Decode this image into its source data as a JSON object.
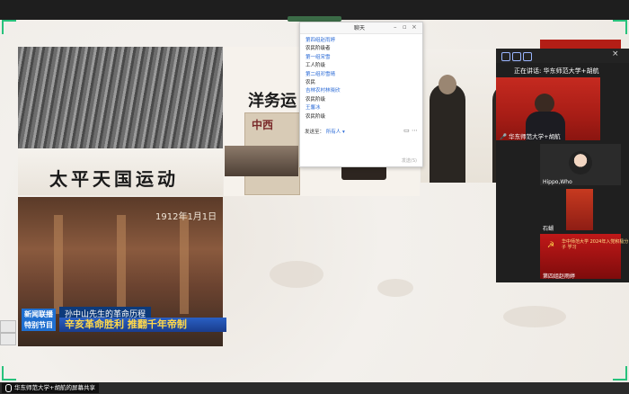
{
  "chat": {
    "title": "聊天",
    "messages": [
      {
        "name": "第四组赵雨婷",
        "text": "农民阶级者"
      },
      {
        "name": "第一组宋雪",
        "text": "工人阶级"
      },
      {
        "name": "第二组邓雪晴",
        "text": "农民"
      },
      {
        "name": "吉林农村林晓欣",
        "text": "农民阶级"
      },
      {
        "name": "王馨冰",
        "text": "农民阶级"
      }
    ],
    "send_to_label": "发送至：",
    "send_to_value": "所有人 ▾",
    "send_button": "发送(S)"
  },
  "slide": {
    "taiping_title": "太平天国运动",
    "yangwu_title": "洋务运",
    "paper_text": "中西",
    "xinhai_date": "1912年1月1日",
    "news_tag_1": "新闻联播",
    "news_tag_2": "特别节目",
    "news_subtitle": "孙中山先生的革命历程",
    "news_headline": "辛亥革命胜利 推翻千年帝制"
  },
  "participants": {
    "speaking_label": "正在讲话: 华东师范大学+胡航",
    "main_video_label": "华东师范大学+胡航",
    "tiles": [
      {
        "label": "Hippo,Who"
      },
      {
        "label": "石蝴"
      },
      {
        "label": "第四组赵雨婷"
      }
    ],
    "tile4_text": "华中师范大学 2024年入党积极分子 学习"
  },
  "statusbar": {
    "share_label": "华东师范大学+胡航的屏幕共享"
  },
  "colors": {
    "accent_green": "#27c27c",
    "zoom_red": "#c52a20",
    "chat_name_blue": "#2a6ad6"
  }
}
